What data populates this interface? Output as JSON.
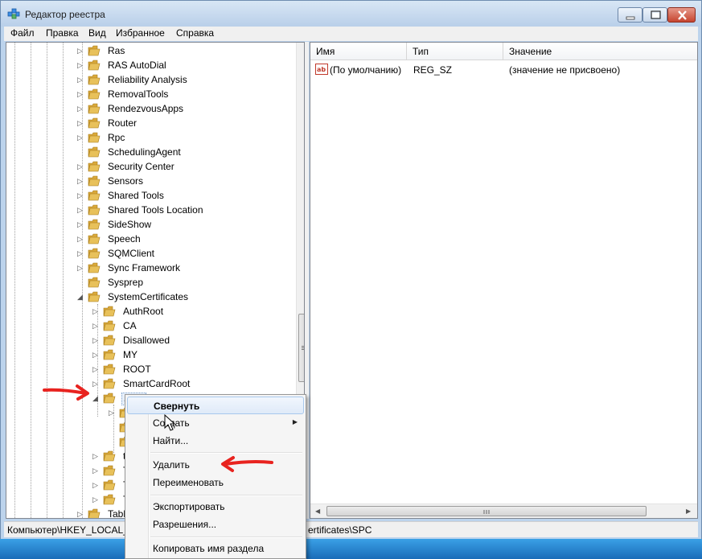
{
  "window": {
    "title": "Редактор реестра"
  },
  "menubar": [
    "Файл",
    "Правка",
    "Вид",
    "Избранное",
    "Справка"
  ],
  "tree": {
    "items": [
      {
        "label": "Ras",
        "expander": "▷"
      },
      {
        "label": "RAS AutoDial",
        "expander": "▷"
      },
      {
        "label": "Reliability Analysis",
        "expander": "▷"
      },
      {
        "label": "RemovalTools",
        "expander": "▷"
      },
      {
        "label": "RendezvousApps",
        "expander": "▷"
      },
      {
        "label": "Router",
        "expander": "▷"
      },
      {
        "label": "Rpc",
        "expander": "▷"
      },
      {
        "label": "SchedulingAgent",
        "expander": ""
      },
      {
        "label": "Security Center",
        "expander": "▷"
      },
      {
        "label": "Sensors",
        "expander": "▷"
      },
      {
        "label": "Shared Tools",
        "expander": "▷"
      },
      {
        "label": "Shared Tools Location",
        "expander": "▷"
      },
      {
        "label": "SideShow",
        "expander": "▷"
      },
      {
        "label": "Speech",
        "expander": "▷"
      },
      {
        "label": "SQMClient",
        "expander": "▷"
      },
      {
        "label": "Sync Framework",
        "expander": "▷"
      },
      {
        "label": "Sysprep",
        "expander": ""
      },
      {
        "label": "SystemCertificates",
        "expander": "◢"
      },
      {
        "label": "AuthRoot",
        "expander": "▷"
      },
      {
        "label": "CA",
        "expander": "▷"
      },
      {
        "label": "Disallowed",
        "expander": "▷"
      },
      {
        "label": "MY",
        "expander": "▷"
      },
      {
        "label": "ROOT",
        "expander": "▷"
      },
      {
        "label": "SmartCardRoot",
        "expander": "▷"
      },
      {
        "label": "SPC",
        "expander": "◢"
      },
      {
        "label": "",
        "expander": "▷"
      },
      {
        "label": "",
        "expander": ""
      },
      {
        "label": "",
        "expander": ""
      },
      {
        "label": "tr",
        "expander": "▷"
      },
      {
        "label": "T",
        "expander": "▷"
      },
      {
        "label": "T",
        "expander": "▷"
      },
      {
        "label": "T",
        "expander": "▷"
      },
      {
        "label": "Table",
        "expander": "▷"
      }
    ]
  },
  "list": {
    "columns": [
      "Имя",
      "Тип",
      "Значение"
    ],
    "rows": [
      {
        "name": "(По умолчанию)",
        "type": "REG_SZ",
        "value": "(значение не присвоено)"
      }
    ]
  },
  "statusbar": {
    "left": "Компьютер\\HKEY_LOCAL_",
    "right": "ertificates\\SPC"
  },
  "context_menu": {
    "items": [
      "Свернуть",
      "Создать",
      "Найти...",
      "Удалить",
      "Переименовать",
      "Экспортировать",
      "Разрешения...",
      "Копировать имя раздела"
    ],
    "highlighted": "Свернуть"
  },
  "colors": {
    "annotation": "#e8231f",
    "folder": "#e8c15a",
    "highlight": "#dfeaf8"
  }
}
